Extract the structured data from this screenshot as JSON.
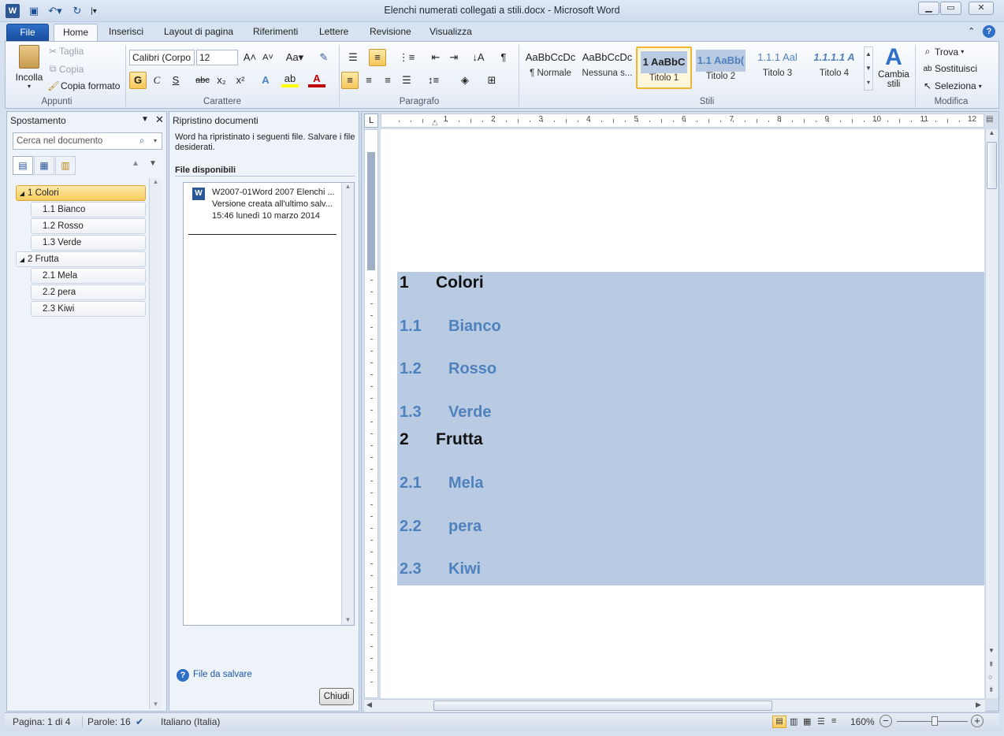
{
  "window": {
    "title": "Elenchi numerati collegati a stili.docx - Microsoft Word"
  },
  "tabs": {
    "file": "File",
    "home": "Home",
    "insert": "Inserisci",
    "layout": "Layout di pagina",
    "references": "Riferimenti",
    "mailings": "Lettere",
    "review": "Revisione",
    "view": "Visualizza"
  },
  "clipboard": {
    "paste": "Incolla",
    "cut": "Taglia",
    "copy": "Copia",
    "format_painter": "Copia formato",
    "label": "Appunti"
  },
  "font": {
    "name": "Calibri (Corpo",
    "size": "12",
    "label": "Carattere",
    "bold": "G",
    "italic": "C",
    "underline": "S",
    "strike": "abc",
    "sub": "x₂",
    "sup": "x²"
  },
  "paragraph": {
    "label": "Paragrafo"
  },
  "styles": {
    "label": "Stili",
    "items": [
      {
        "preview": "AaBbCcDc",
        "name": "¶ Normale"
      },
      {
        "preview": "AaBbCcDc",
        "name": "Nessuna s..."
      },
      {
        "preview": "1  AaBbC",
        "name": "Titolo 1"
      },
      {
        "preview": "1.1  AaBb(",
        "name": "Titolo 2"
      },
      {
        "preview": "1.1.1  Aal",
        "name": "Titolo 3"
      },
      {
        "preview": "1.1.1.1  A",
        "name": "Titolo 4"
      }
    ],
    "change": "Cambia stili"
  },
  "editing": {
    "label": "Modifica",
    "find": "Trova",
    "replace": "Sostituisci",
    "select": "Seleziona"
  },
  "nav": {
    "title": "Spostamento",
    "search_placeholder": "Cerca nel documento",
    "items": [
      {
        "label": "1 Colori",
        "level": 1
      },
      {
        "label": "1.1 Bianco",
        "level": 2
      },
      {
        "label": "1.2 Rosso",
        "level": 2
      },
      {
        "label": "1.3 Verde",
        "level": 2
      },
      {
        "label": "2 Frutta",
        "level": 1
      },
      {
        "label": "2.1 Mela",
        "level": 2
      },
      {
        "label": "2.2 pera",
        "level": 2
      },
      {
        "label": "2.3 Kiwi",
        "level": 2
      }
    ]
  },
  "recovery": {
    "title": "Ripristino documenti",
    "message": "Word ha ripristinato i seguenti file. Salvare i file desiderati.",
    "available": "File disponibili",
    "file_name": "W2007-01Word 2007 Elenchi ...",
    "file_version": "Versione creata all'ultimo salv...",
    "file_time": "15:46 lunedì 10 marzo 2014",
    "help_link": "File da salvare",
    "close": "Chiudi"
  },
  "document": {
    "headings": [
      {
        "num": "1",
        "text": "Colori",
        "level": 1
      },
      {
        "num": "1.1",
        "text": "Bianco",
        "level": 2
      },
      {
        "num": "1.2",
        "text": "Rosso",
        "level": 2
      },
      {
        "num": "1.3",
        "text": "Verde",
        "level": 2
      },
      {
        "num": "2",
        "text": "Frutta",
        "level": 1
      },
      {
        "num": "2.1",
        "text": "Mela",
        "level": 2
      },
      {
        "num": "2.2",
        "text": "pera",
        "level": 2
      },
      {
        "num": "2.3",
        "text": "Kiwi",
        "level": 2
      }
    ]
  },
  "ruler": {
    "numbers": [
      "1",
      "2",
      "3",
      "4",
      "5",
      "6",
      "7",
      "8",
      "9",
      "10",
      "11",
      "12"
    ]
  },
  "status": {
    "page": "Pagina: 1 di 4",
    "words": "Parole: 16",
    "language": "Italiano (Italia)",
    "zoom": "160%"
  },
  "colors": {
    "heading2": "#4f81bd",
    "selection": "#b9cbe3",
    "accent": "#1a4f9e"
  }
}
